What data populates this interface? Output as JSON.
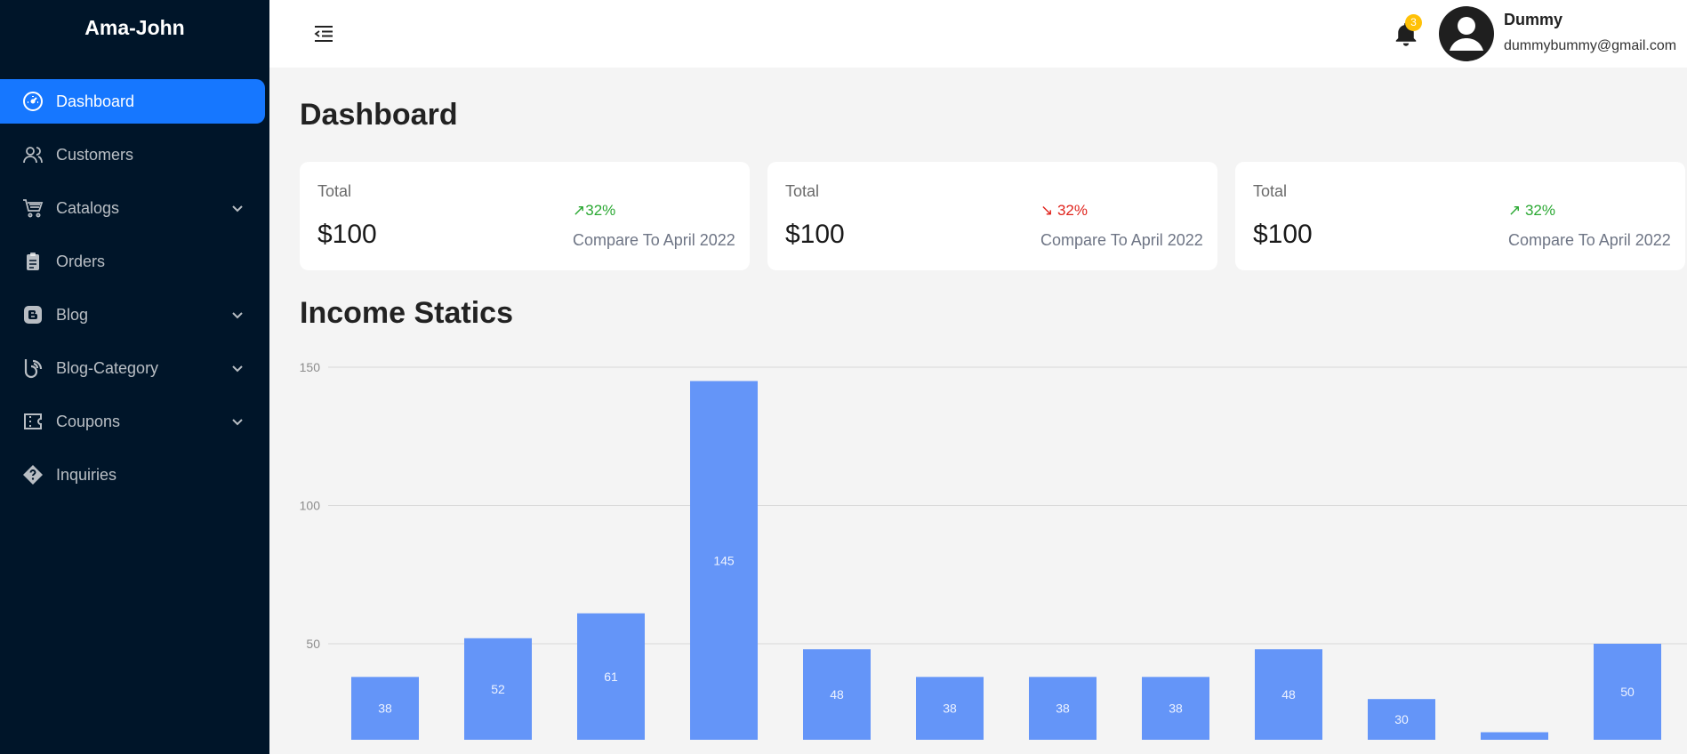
{
  "sidebar": {
    "brand": "Ama-John",
    "items": [
      {
        "label": "Dashboard",
        "icon": "dashboard-icon",
        "active": true
      },
      {
        "label": "Customers",
        "icon": "users-icon"
      },
      {
        "label": "Catalogs",
        "icon": "cart-icon",
        "expandable": true
      },
      {
        "label": "Orders",
        "icon": "clipboard-icon"
      },
      {
        "label": "Blog",
        "icon": "blogger-icon",
        "expandable": true
      },
      {
        "label": "Blog-Category",
        "icon": "blog-category-icon",
        "expandable": true
      },
      {
        "label": "Coupons",
        "icon": "coupon-icon",
        "expandable": true
      },
      {
        "label": "Inquiries",
        "icon": "question-diamond-icon"
      }
    ]
  },
  "header": {
    "notification_count": "3",
    "user": {
      "name": "Dummy",
      "email": "dummybummy@gmail.com"
    }
  },
  "main": {
    "title": "Dashboard",
    "cards": [
      {
        "label": "Total",
        "value": "$100",
        "change": "↗32%",
        "trend": "up",
        "compare": "Compare To April 2022"
      },
      {
        "label": "Total",
        "value": "$100",
        "change": "↘ 32%",
        "trend": "down",
        "compare": "Compare To April 2022"
      },
      {
        "label": "Total",
        "value": "$100",
        "change": "↗ 32%",
        "trend": "up",
        "compare": "Compare To April 2022"
      }
    ],
    "income_title": "Income Statics"
  },
  "colors": {
    "sidebar_bg": "#001529",
    "active": "#1677ff",
    "bar": "#6495f8",
    "badge": "#ffc107",
    "up": "#2aa832",
    "down": "#e0241d"
  },
  "chart_data": {
    "type": "bar",
    "categories": [
      "",
      "",
      "",
      "",
      "",
      "",
      "",
      "",
      "",
      "",
      "",
      ""
    ],
    "values": [
      38,
      52,
      61,
      145,
      48,
      38,
      38,
      38,
      48,
      30,
      18,
      50
    ],
    "data_labels": [
      "38",
      "52",
      "61",
      "145",
      "48",
      "38",
      "38",
      "38",
      "48",
      "30",
      "",
      "50"
    ],
    "yticks": [
      50,
      100,
      150
    ],
    "ylim_visible": [
      15,
      150
    ],
    "grid": true,
    "title": "",
    "xlabel": "",
    "ylabel": ""
  }
}
